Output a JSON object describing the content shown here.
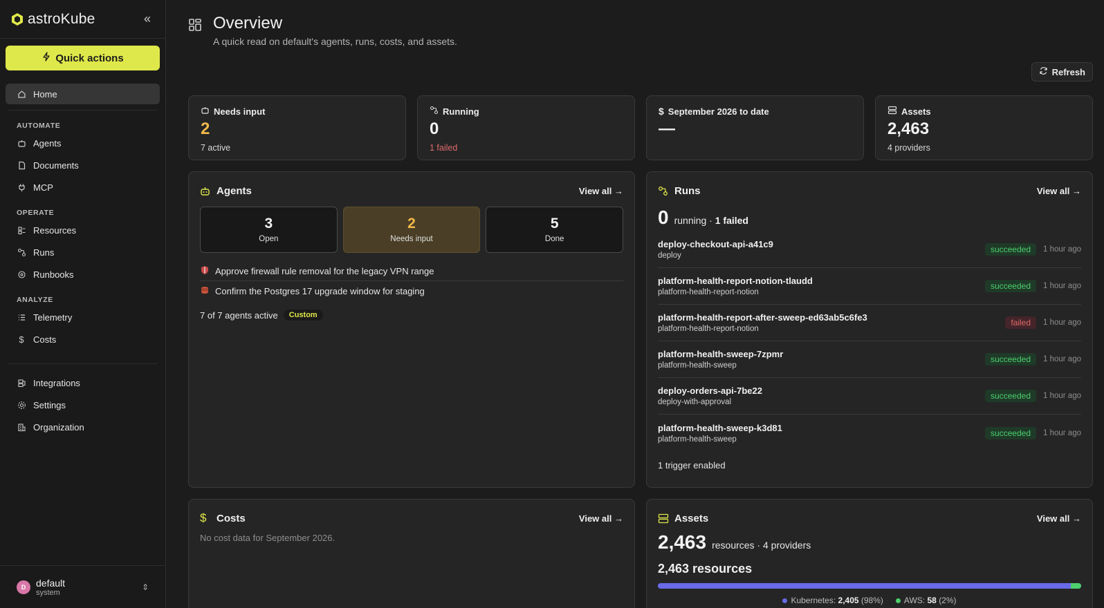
{
  "brand": {
    "name": "astroKube"
  },
  "sidebar": {
    "quick_actions": "Quick actions",
    "home": "Home",
    "sections": {
      "automate": "AUTOMATE",
      "operate": "OPERATE",
      "analyze": "ANALYZE"
    },
    "automate_items": [
      "Agents",
      "Documents",
      "MCP"
    ],
    "operate_items": [
      "Resources",
      "Runs",
      "Runbooks"
    ],
    "analyze_items": [
      "Telemetry",
      "Costs"
    ],
    "bottom_items": [
      "Integrations",
      "Settings",
      "Organization"
    ],
    "account": {
      "initial": "D",
      "name": "default",
      "role": "system"
    }
  },
  "header": {
    "title": "Overview",
    "subtitle": "A quick read on default's agents, runs, costs, and assets.",
    "refresh": "Refresh"
  },
  "stats": [
    {
      "label": "Needs input",
      "value": "2",
      "foot": "7 active",
      "icon": "robot-icon"
    },
    {
      "label": "Running",
      "value": "0",
      "foot": "1 failed",
      "icon": "runs-icon"
    },
    {
      "label": "September 2026 to date",
      "value": "—",
      "foot": "",
      "icon": "dollar-icon"
    },
    {
      "label": "Assets",
      "value": "2,463",
      "foot": "4 providers",
      "icon": "database-icon"
    }
  ],
  "agents": {
    "title": "Agents",
    "view_all": "View all",
    "tiles": [
      {
        "value": "3",
        "label": "Open"
      },
      {
        "value": "2",
        "label": "Needs input"
      },
      {
        "value": "5",
        "label": "Done"
      }
    ],
    "tasks": [
      "Approve firewall rule removal for the legacy VPN range",
      "Confirm the Postgres 17 upgrade window for staging"
    ],
    "footer": "7 of 7 agents active",
    "badge": "Custom"
  },
  "runs": {
    "title": "Runs",
    "view_all": "View all",
    "count": "0",
    "count_label": "running ·",
    "failed": "1 failed",
    "items": [
      {
        "name": "deploy-checkout-api-a41c9",
        "sub": "deploy",
        "status": "succeeded",
        "time": "1 hour ago"
      },
      {
        "name": "platform-health-report-notion-tlaudd",
        "sub": "platform-health-report-notion",
        "status": "succeeded",
        "time": "1 hour ago"
      },
      {
        "name": "platform-health-report-after-sweep-ed63ab5c6fe3",
        "sub": "platform-health-report-notion",
        "status": "failed",
        "time": "1 hour ago"
      },
      {
        "name": "platform-health-sweep-7zpmr",
        "sub": "platform-health-sweep",
        "status": "succeeded",
        "time": "1 hour ago"
      },
      {
        "name": "deploy-orders-api-7be22",
        "sub": "deploy-with-approval",
        "status": "succeeded",
        "time": "1 hour ago"
      },
      {
        "name": "platform-health-sweep-k3d81",
        "sub": "platform-health-sweep",
        "status": "succeeded",
        "time": "1 hour ago"
      }
    ],
    "trigger": "1 trigger enabled"
  },
  "costs": {
    "title": "Costs",
    "view_all": "View all",
    "empty": "No cost data for September 2026."
  },
  "assets": {
    "title": "Assets",
    "view_all": "View all",
    "count": "2,463",
    "count_label": "resources · 4 providers",
    "resources": "2,463 resources",
    "legend": [
      {
        "name": "Kubernetes:",
        "value": "2,405",
        "pct": "(98%)",
        "color": "#6a6ae8",
        "fraction": 0.976
      },
      {
        "name": "AWS:",
        "value": "58",
        "pct": "(2%)",
        "color": "#4ccf6d",
        "fraction": 0.024
      }
    ]
  }
}
